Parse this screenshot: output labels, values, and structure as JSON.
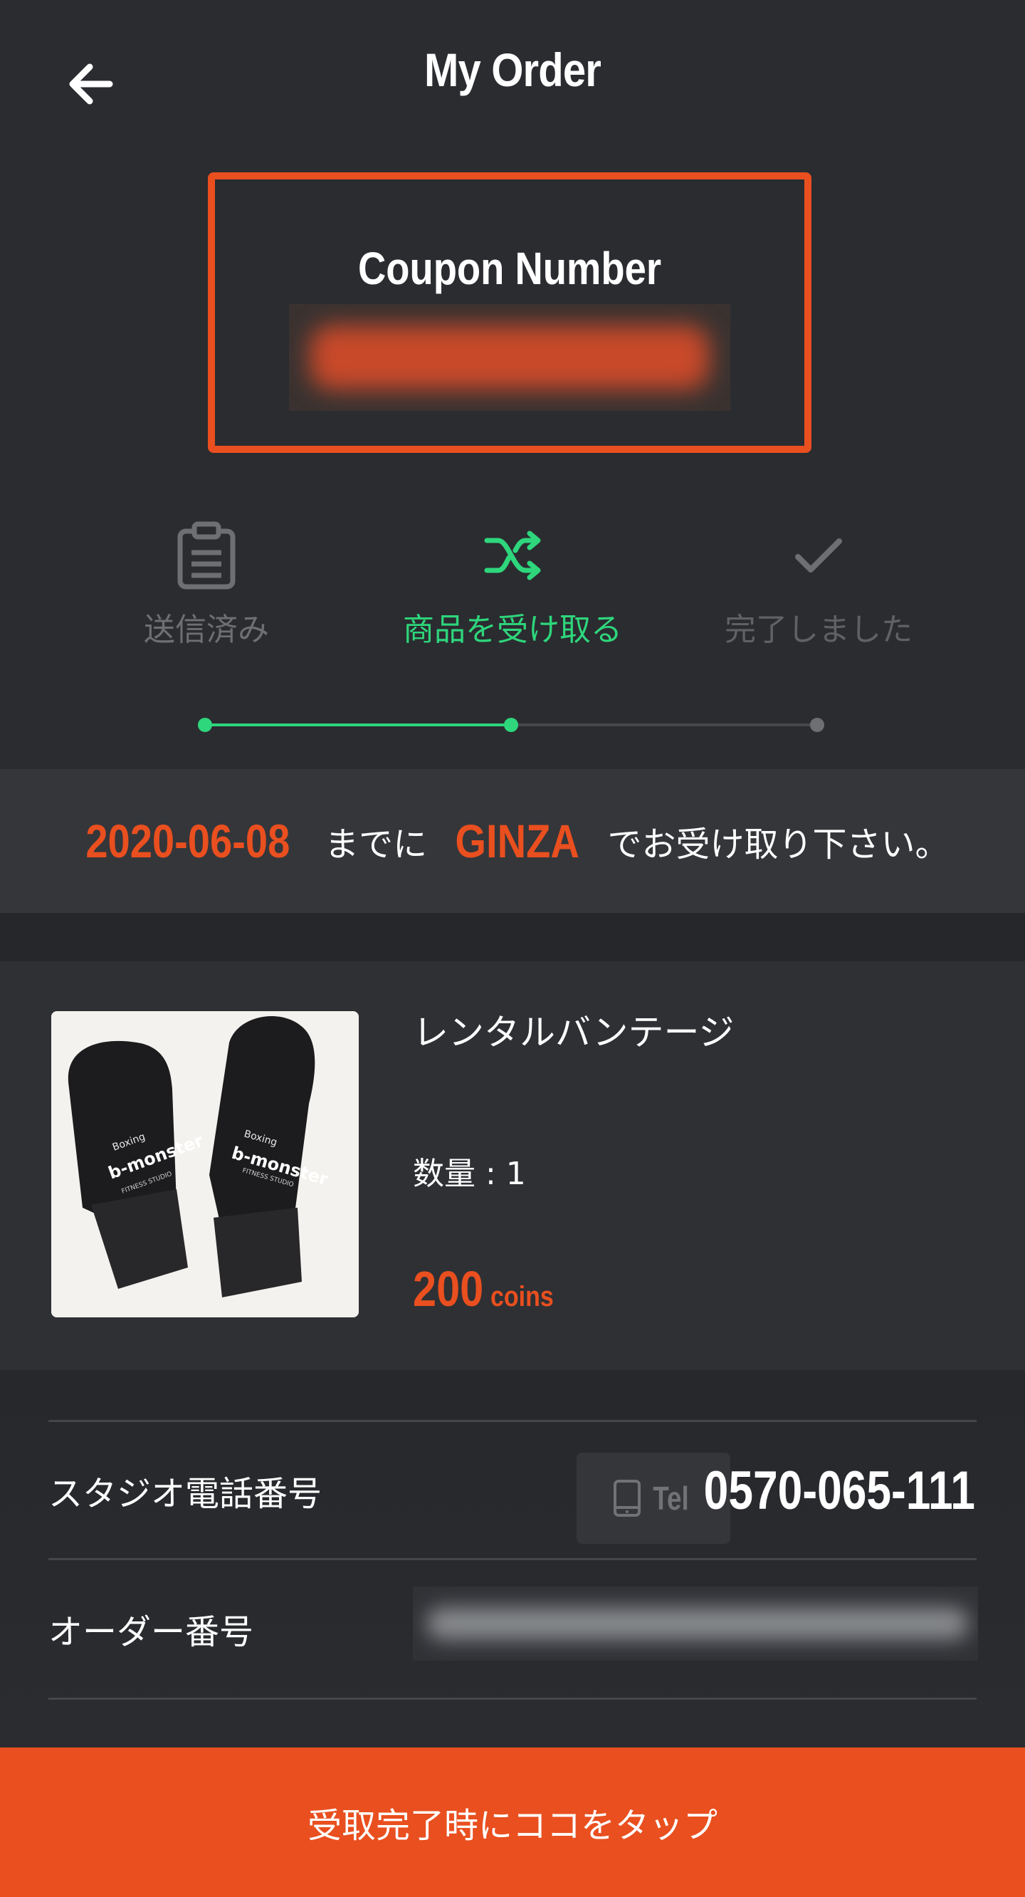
{
  "header": {
    "title": "My Order"
  },
  "coupon": {
    "label": "Coupon Number"
  },
  "steps": [
    {
      "label": "送信済み",
      "icon": "clipboard-icon",
      "state": "done"
    },
    {
      "label": "商品を受け取る",
      "icon": "shuffle-icon",
      "state": "active"
    },
    {
      "label": "完了しました",
      "icon": "check-icon",
      "state": "pending"
    }
  ],
  "notice": {
    "date": "2020-06-08",
    "text1": "までに",
    "location": "GINZA",
    "text2": "でお受け取り下さい。"
  },
  "product": {
    "name": "レンタルバンテージ",
    "quantity": "数量 : 1",
    "price": "200",
    "price_unit": "coins",
    "image_brand": "b-monster",
    "image_sub": "FITNESS STUDIO",
    "image_top": "Boxing"
  },
  "info": {
    "phone_label": "スタジオ電話番号",
    "tel_button": "Tel",
    "phone_number": "0570-065-111",
    "order_label": "オーダー番号"
  },
  "cta": {
    "label": "受取完了時にココをタップ"
  },
  "colors": {
    "accent": "#e94f1f",
    "success": "#2ed67c",
    "background": "#2a2c30"
  }
}
